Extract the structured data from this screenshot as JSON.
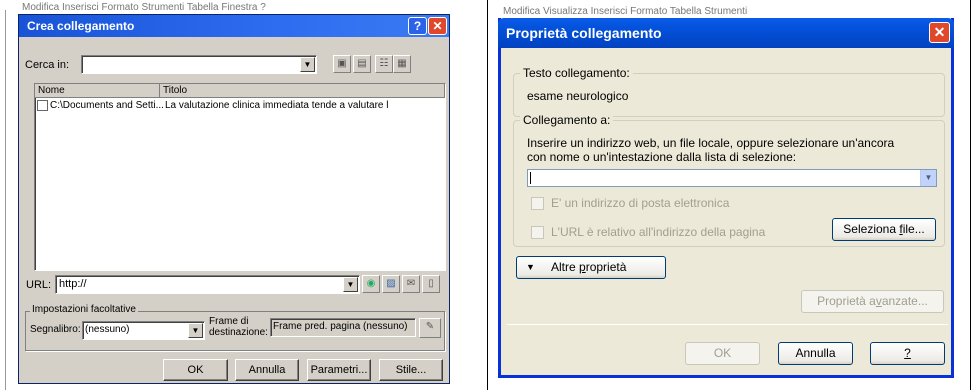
{
  "background": {
    "left_menu": "Modifica  Inserisci  Formato  Strumenti  Tabella  Finestra  ?",
    "right_menu": "Modifica  Visualizza  Inserisci  Formato  Tabella  Strumenti"
  },
  "dialog_left": {
    "title": "Crea collegamento",
    "help_glyph": "?",
    "close_glyph": "✕",
    "cerca_label": "Cerca in:",
    "cerca_value": "",
    "columns": [
      "Nome",
      "Titolo"
    ],
    "rows": [
      {
        "name": "C:\\Documents and Setti...",
        "title": "La valutazione clinica immediata tende a valutare l"
      }
    ],
    "url_label": "URL:",
    "url_value": "http://",
    "optional_group": "Impostazioni facoltative",
    "segnalibro_label": "Segnalibro:",
    "segnalibro_value": "(nessuno)",
    "frame_label_1": "Frame di",
    "frame_label_2": "destinazione:",
    "frame_value": "Frame pred. pagina (nessuno)",
    "buttons": {
      "ok": "OK",
      "cancel": "Annulla",
      "params": "Parametri...",
      "style": "Stile..."
    }
  },
  "dialog_right": {
    "title": "Proprietà collegamento",
    "close_glyph": "✕",
    "testo_legend": "Testo collegamento:",
    "testo_value": "esame neurologico",
    "coll_legend": "Collegamento a:",
    "instruction_1": "Inserire un indirizzo web, un file locale, oppure selezionare un'ancora",
    "instruction_2": "con nome o un'intestazione dalla lista di selezione:",
    "address_value": "",
    "checkbox_email": "E' un indirizzo di posta elettronica",
    "checkbox_relative": "L'URL è relativo all'indirizzo della pagina",
    "select_file_pre": "Seleziona ",
    "select_file_u": "f",
    "select_file_post": "ile...",
    "more_props_pre": "Altre ",
    "more_props_u": "p",
    "more_props_post": "roprietà",
    "advanced_pre": "Proprietà a",
    "advanced_u": "v",
    "advanced_post": "anzate...",
    "ok": "OK",
    "cancel": "Annulla",
    "help": "?"
  }
}
